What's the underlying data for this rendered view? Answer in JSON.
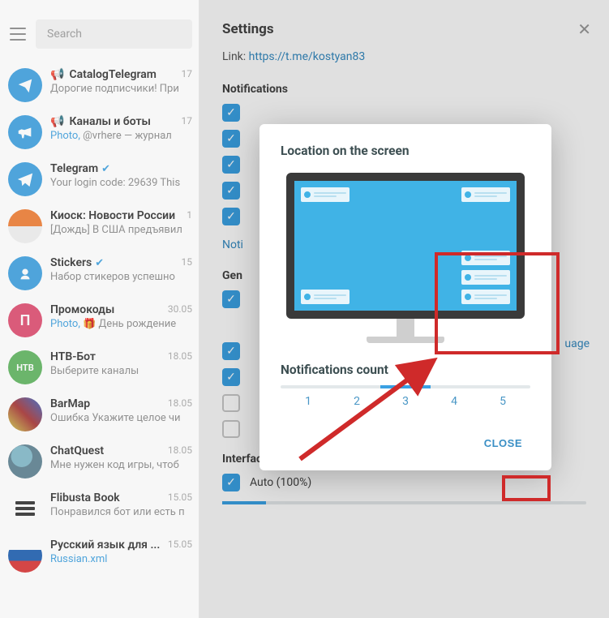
{
  "left": {
    "search_placeholder": "Search",
    "chats": [
      {
        "title": "CatalogTelegram",
        "sub": "Дорогие подписчики! При",
        "date": "17",
        "icon_bullhorn": true
      },
      {
        "title": "Каналы и боты",
        "sub_prefix": "Photo, ",
        "sub": "@vrhere — журнал",
        "date": "17",
        "icon_bullhorn": true
      },
      {
        "title": "Telegram",
        "sub": "Your login code: 29639  This",
        "date": "",
        "verified": true
      },
      {
        "title": "Киоск: Новости России",
        "sub": "[Дождь]  В США предъявил",
        "date": "1"
      },
      {
        "title": "Stickers",
        "sub": "Набор стикеров успешно",
        "date": "15",
        "verified": true
      },
      {
        "title": "Промокоды",
        "sub_prefix": "Photo, ",
        "sub": "🎁 День рождение",
        "date": "30.05"
      },
      {
        "title": "НТВ-Бот",
        "sub": "Выберите каналы",
        "date": "18.05"
      },
      {
        "title": "BarMap",
        "sub": "Ошибка Укажите целое чи",
        "date": "18.05"
      },
      {
        "title": "ChatQuest",
        "sub": "Мне нужен код игры, чтоб",
        "date": "18.05"
      },
      {
        "title": "Flibusta Book",
        "sub": "Понравился бот или есть п",
        "date": "15.05"
      },
      {
        "title": "Русский язык для ...",
        "sub_link": "Russian.xml",
        "date": "15.05"
      }
    ]
  },
  "settings": {
    "title": "Settings",
    "link_label": "Link:",
    "link_url": "https://t.me/kostyan83",
    "section_notifications": "Notifications",
    "notification_link": "Noti",
    "section_general": "Gen",
    "language_link": "uage",
    "section_interface": "Interface Scale",
    "auto_label": "Auto (100%)"
  },
  "modal": {
    "location_title": "Location on the screen",
    "count_title": "Notifications count",
    "counts": [
      "1",
      "2",
      "3",
      "4",
      "5"
    ],
    "selected_index": 2,
    "close": "CLOSE"
  }
}
